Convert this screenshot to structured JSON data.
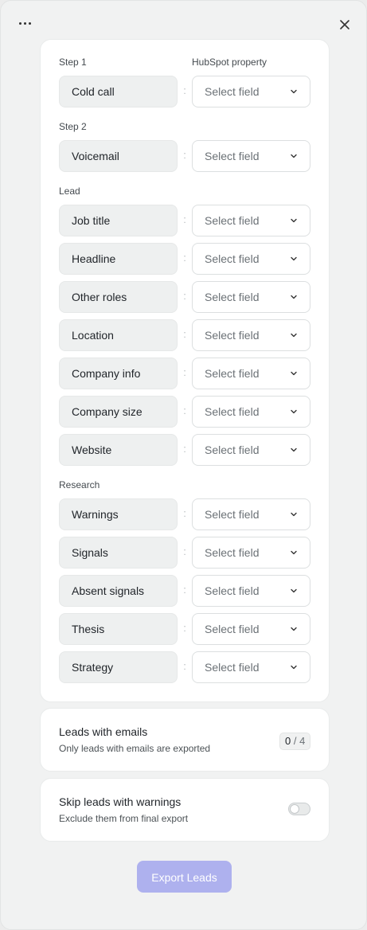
{
  "header": {
    "more_icon": "more-horizontal-icon",
    "close_icon": "close-icon"
  },
  "mapping": {
    "column_label": "HubSpot property",
    "separator": ":",
    "select_placeholder": "Select field",
    "sections": [
      {
        "label": "Step 1",
        "fields": [
          "Cold call"
        ]
      },
      {
        "label": "Step 2",
        "fields": [
          "Voicemail"
        ]
      },
      {
        "label": "Lead",
        "fields": [
          "Job title",
          "Headline",
          "Other roles",
          "Location",
          "Company info",
          "Company size",
          "Website"
        ]
      },
      {
        "label": "Research",
        "fields": [
          "Warnings",
          "Signals",
          "Absent signals",
          "Thesis",
          "Strategy"
        ]
      }
    ]
  },
  "emails": {
    "title": "Leads with emails",
    "subtitle": "Only leads with emails are exported",
    "count": "0",
    "separator": "/",
    "total": "4"
  },
  "warnings": {
    "title": "Skip leads with warnings",
    "subtitle": "Exclude them from final export",
    "enabled": false
  },
  "export_label": "Export Leads",
  "colors": {
    "accent": "#aeb1ee",
    "card": "#ffffff",
    "panel": "#f1f2f2"
  }
}
